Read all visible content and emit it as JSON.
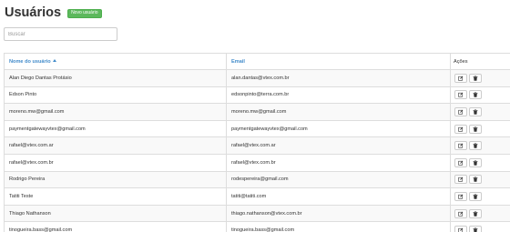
{
  "header": {
    "title": "Usuários",
    "new_user_label": "Novo usuário"
  },
  "search": {
    "placeholder": "Buscar"
  },
  "table": {
    "columns": {
      "name": "Nome do usuário",
      "email": "Email",
      "actions": "Ações"
    },
    "sort": {
      "column": "name",
      "direction": "ascending"
    },
    "rows": [
      {
        "name": "Alan Diego Dantas Protásio",
        "email": "alan.dantas@vtex.com.br"
      },
      {
        "name": "Edson Pinto",
        "email": "edsonpinto@terra.com.br"
      },
      {
        "name": "moreno.mw@gmail.com",
        "email": "moreno.mw@gmail.com"
      },
      {
        "name": "paymentgatewayvtex@gmail.com",
        "email": "paymentgatewayvtex@gmail.com"
      },
      {
        "name": "rafael@vtex.com.ar",
        "email": "rafael@vtex.com.ar"
      },
      {
        "name": "rafael@vtex.com.br",
        "email": "rafael@vtex.com.br"
      },
      {
        "name": "Rodrigo Pereira",
        "email": "rodespereira@gmail.com"
      },
      {
        "name": "Tatiti Teste",
        "email": "tatiti@tatiti.com"
      },
      {
        "name": "Thiago Nathanson",
        "email": "thiago.nathanson@vtex.com.br"
      },
      {
        "name": "tinogueira.bass@gmail.com",
        "email": "tinogueira.bass@gmail.com"
      }
    ],
    "row_actions": {
      "edit_icon": "edit-icon",
      "delete_icon": "trash-icon"
    }
  },
  "colors": {
    "primary_button": "#5cb85c",
    "link": "#428bca",
    "border": "#dddddd",
    "stripe": "#f9f9f9"
  }
}
